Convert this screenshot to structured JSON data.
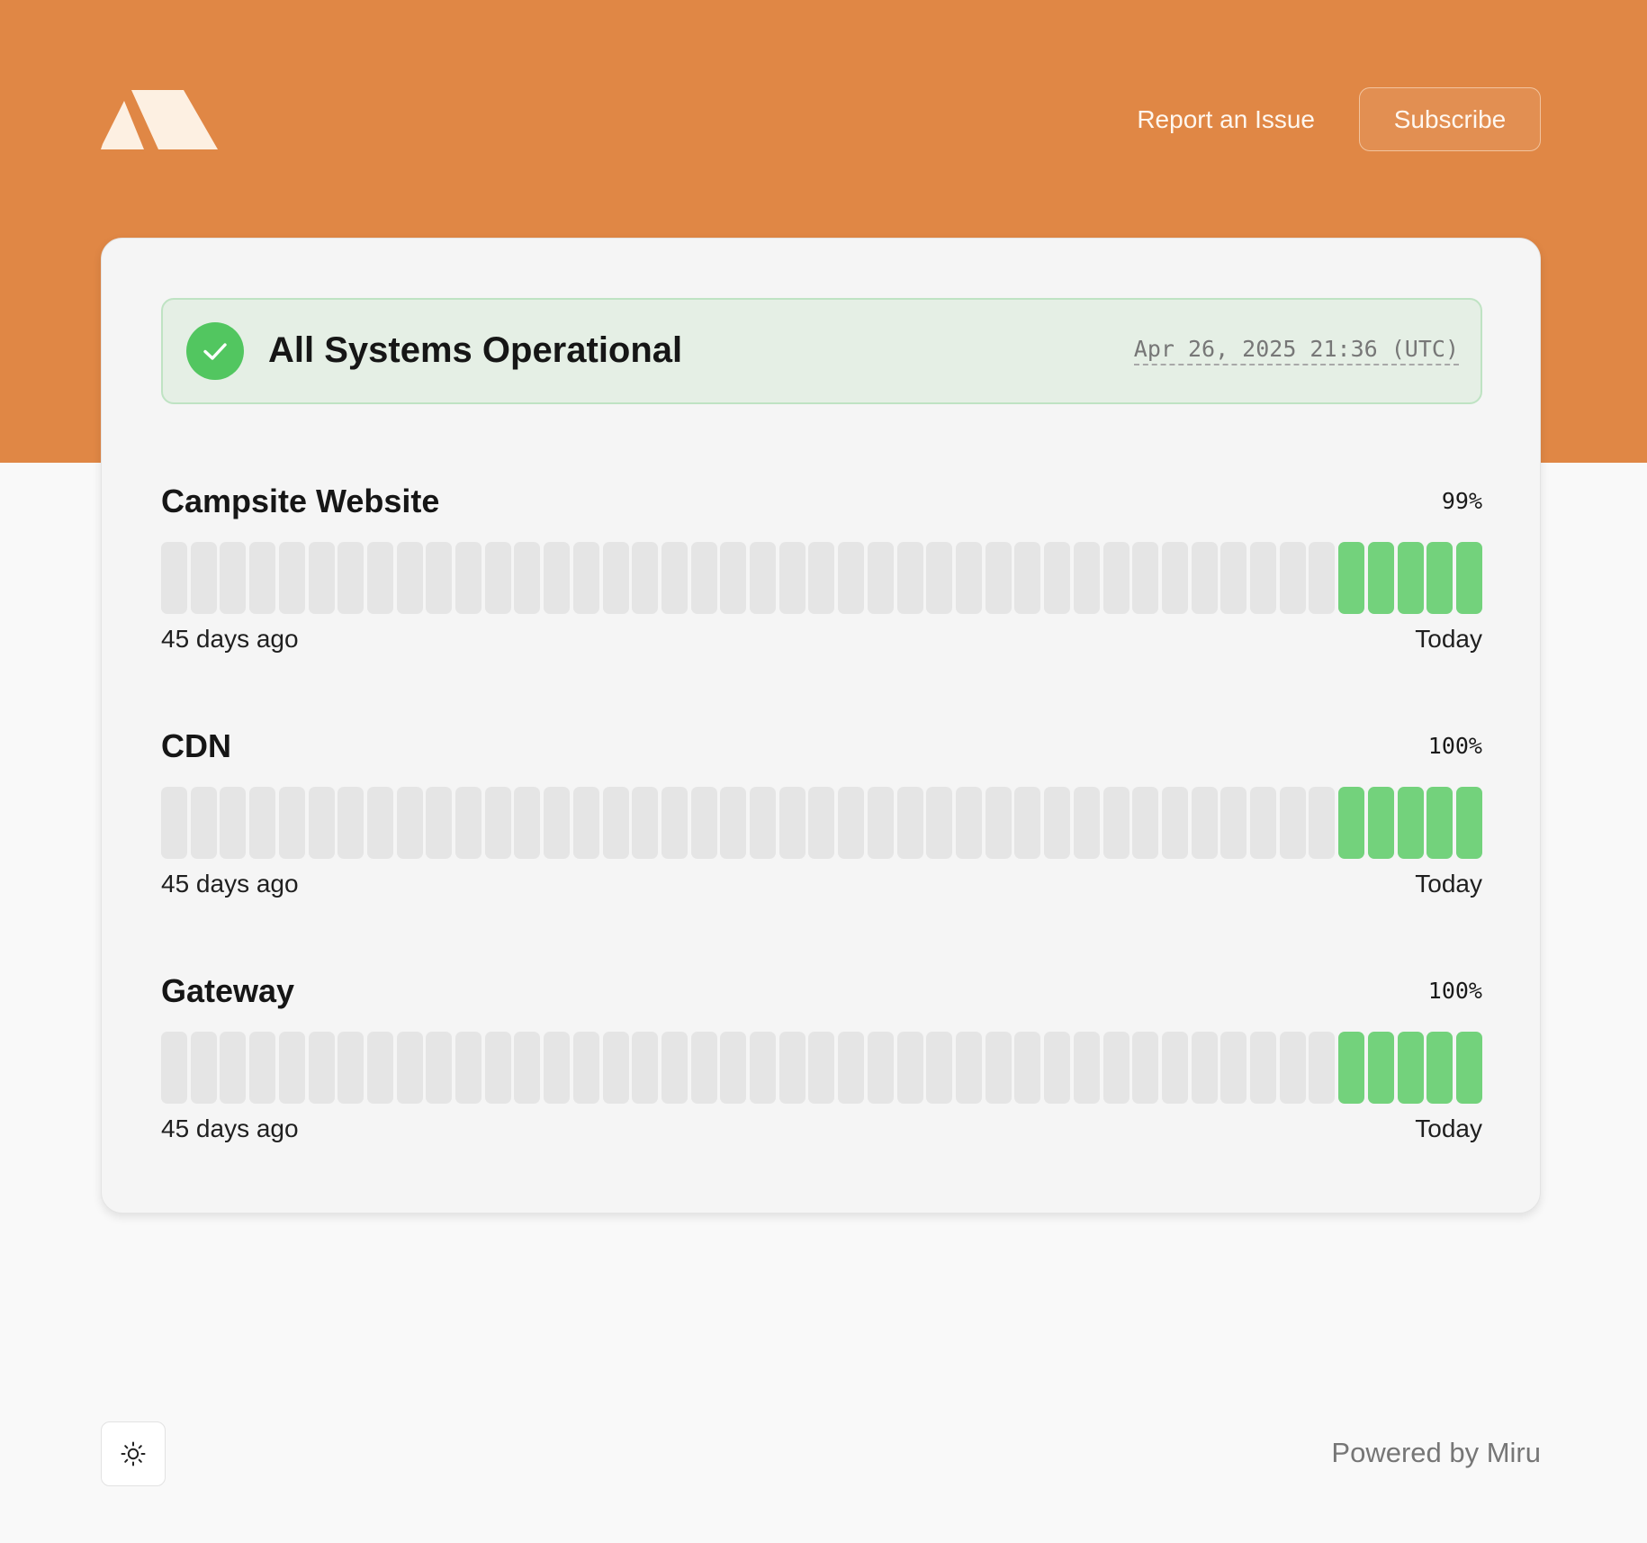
{
  "header": {
    "logo_icon": "mountain-logo-icon",
    "report_link": "Report an Issue",
    "subscribe_button": "Subscribe",
    "banner_color": "#e08745"
  },
  "status": {
    "icon": "check-circle-icon",
    "title": "All Systems Operational",
    "timestamp": "Apr 26, 2025 21:36 (UTC)",
    "color": "#52c660"
  },
  "monitors": [
    {
      "name": "Campsite Website",
      "uptime": "99%",
      "start_label": "45 days ago",
      "end_label": "Today",
      "bars_total": 45,
      "bars_with_data": 5
    },
    {
      "name": "CDN",
      "uptime": "100%",
      "start_label": "45 days ago",
      "end_label": "Today",
      "bars_total": 45,
      "bars_with_data": 5
    },
    {
      "name": "Gateway",
      "uptime": "100%",
      "start_label": "45 days ago",
      "end_label": "Today",
      "bars_total": 45,
      "bars_with_data": 5
    }
  ],
  "colors": {
    "bar_up": "#73d27c",
    "bar_nodata": "#e5e5e5"
  },
  "footer": {
    "theme_toggle_icon": "sun-icon",
    "powered_by": "Powered by Miru"
  }
}
